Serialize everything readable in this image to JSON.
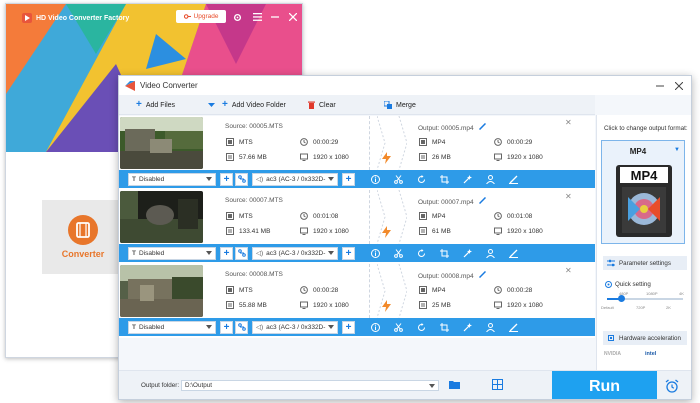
{
  "back_window": {
    "title": "HD Video Converter Factory",
    "upgrade_label": "Upgrade",
    "converter_label": "Converter"
  },
  "main_window": {
    "title": "Video Converter",
    "toolbar": {
      "add_files": "Add Files",
      "add_video_folder": "Add Video Folder",
      "clear": "Clear",
      "merge": "Merge"
    },
    "files": [
      {
        "source": "Source: 00005.MTS",
        "src_format": "MTS",
        "src_duration": "00:00:29",
        "src_size": "57.66 MB",
        "src_res": "1920 x 1080",
        "output": "Output: 00005.mp4",
        "out_format": "MP4",
        "out_duration": "00:00:29",
        "out_size": "26 MB",
        "out_res": "1920 x 1080",
        "subtitle": "Disabled",
        "audio": "ac3 (AC-3 / 0x332D-"
      },
      {
        "source": "Source: 00007.MTS",
        "src_format": "MTS",
        "src_duration": "00:01:08",
        "src_size": "133.41 MB",
        "src_res": "1920 x 1080",
        "output": "Output: 00007.mp4",
        "out_format": "MP4",
        "out_duration": "00:01:08",
        "out_size": "61 MB",
        "out_res": "1920 x 1080",
        "subtitle": "Disabled",
        "audio": "ac3 (AC-3 / 0x332D-"
      },
      {
        "source": "Source: 00008.MTS",
        "src_format": "MTS",
        "src_duration": "00:00:28",
        "src_size": "55.88 MB",
        "src_res": "1920 x 1080",
        "output": "Output: 00008.mp4",
        "out_format": "MP4",
        "out_duration": "00:00:28",
        "out_size": "25 MB",
        "out_res": "1920 x 1080",
        "subtitle": "Disabled",
        "audio": "ac3 (AC-3 / 0x332D-"
      }
    ],
    "right_panel": {
      "title": "Click to change output format:",
      "format": "MP4",
      "parameter_settings": "Parameter settings",
      "quick_setting": "Quick setting",
      "ticks_top": [
        "480P",
        "1080P",
        "4K"
      ],
      "ticks_bottom": [
        "Default",
        "720P",
        "2K"
      ],
      "hardware_acceleration": "Hardware acceleration",
      "nvidia": "NVIDIA",
      "intel": "intel"
    },
    "bottom": {
      "output_folder_label": "Output folder:",
      "output_folder_value": "D:\\Output",
      "run": "Run"
    }
  },
  "colors": {
    "accent": "#2e9be8",
    "run": "#1ea1f0",
    "orange": "#e8762b"
  }
}
